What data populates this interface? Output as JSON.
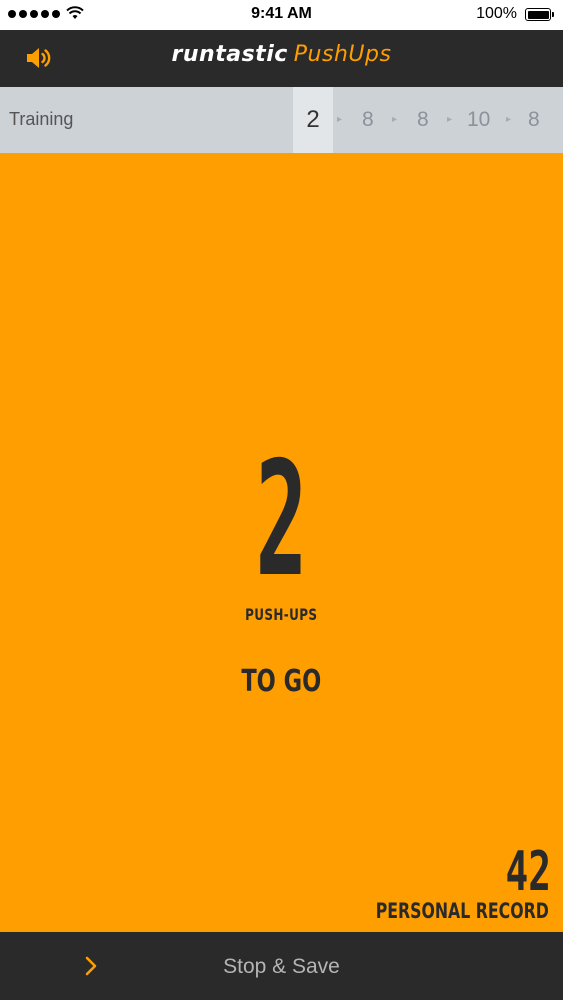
{
  "status_bar": {
    "time": "9:41 AM",
    "battery": "100%",
    "signal_icon": "signal-dots-icon",
    "wifi_icon": "wifi-icon",
    "battery_icon": "battery-icon"
  },
  "header": {
    "sound_icon": "speaker-icon",
    "logo_brand": "runtastic",
    "logo_product": "PushUps"
  },
  "training": {
    "label": "Training",
    "sets": [
      "2",
      "8",
      "8",
      "10",
      "8"
    ],
    "active_set_index": 0
  },
  "counter": {
    "value": "2",
    "unit_label": "PUSH-UPS",
    "suffix_label": "TO GO"
  },
  "record": {
    "value": "42",
    "label": "PERSONAL RECORD"
  },
  "footer": {
    "expand_icon": "chevron-right-icon",
    "stop_save_label": "Stop & Save"
  },
  "colors": {
    "accent": "#ff9e00",
    "dark": "#2a2a2a",
    "training_bar": "#cdd2d7"
  }
}
